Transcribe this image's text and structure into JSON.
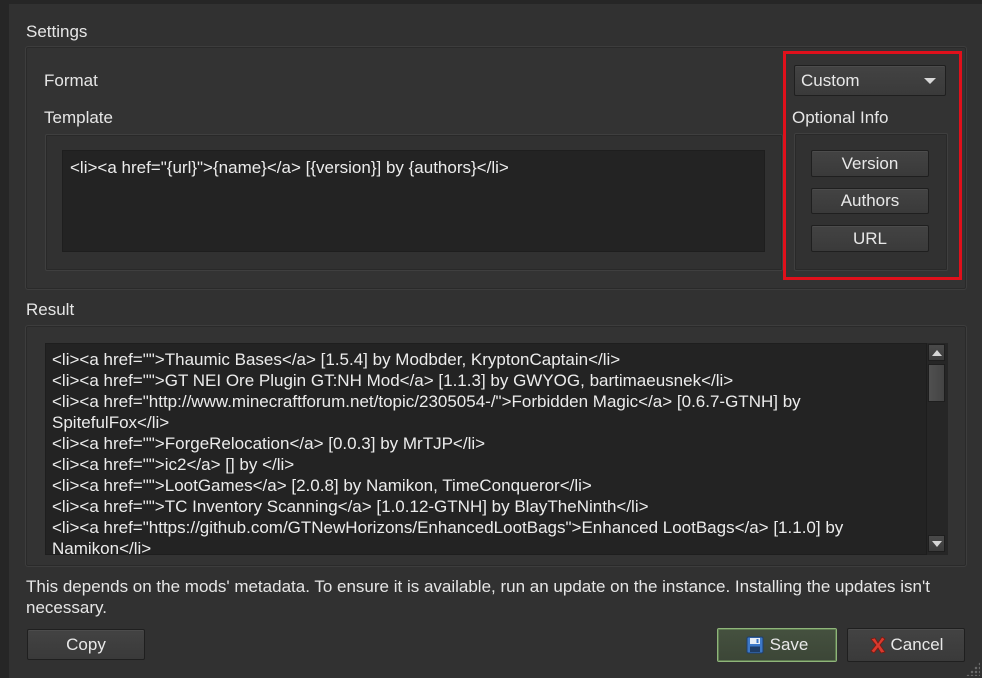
{
  "settings": {
    "title": "Settings",
    "format_label": "Format",
    "format_value": "Custom",
    "template_label": "Template",
    "template_value": "<li><a href=\"{url}\">{name}</a> [{version}] by {authors}</li>",
    "optional_info_label": "Optional Info",
    "optional_buttons": [
      "Version",
      "Authors",
      "URL"
    ]
  },
  "result": {
    "label": "Result",
    "lines": [
      "<li><a href=\"\">Thaumic Bases</a> [1.5.4] by Modbder, KryptonCaptain</li>",
      "<li><a href=\"\">GT NEI Ore Plugin GT:NH Mod</a> [1.1.3] by GWYOG, bartimaeusnek</li>",
      "<li><a href=\"http://www.minecraftforum.net/topic/2305054-/\">Forbidden Magic</a> [0.6.7-GTNH] by",
      "SpitefulFox</li>",
      "<li><a href=\"\">ForgeRelocation</a> [0.0.3] by MrTJP</li>",
      "<li><a href=\"\">ic2</a> [] by </li>",
      "<li><a href=\"\">LootGames</a> [2.0.8] by Namikon, TimeConqueror</li>",
      "<li><a href=\"\">TC Inventory Scanning</a> [1.0.12-GTNH] by BlayTheNinth</li>",
      "<li><a href=\"https://github.com/GTNewHorizons/EnhancedLootBags\">Enhanced LootBags</a> [1.1.0] by",
      "Namikon</li>"
    ]
  },
  "note": "This depends on the mods' metadata. To ensure it is available, run an update on the instance. Installing the updates isn't necessary.",
  "buttons": {
    "copy": "Copy",
    "save": "Save",
    "cancel": "Cancel"
  },
  "icons": {
    "save": "floppy-disk-icon",
    "cancel": "red-x-icon",
    "format_dropdown": "chevron-down-icon"
  },
  "colors": {
    "highlight": "#e0101b",
    "save_border": "#8fb57a"
  }
}
